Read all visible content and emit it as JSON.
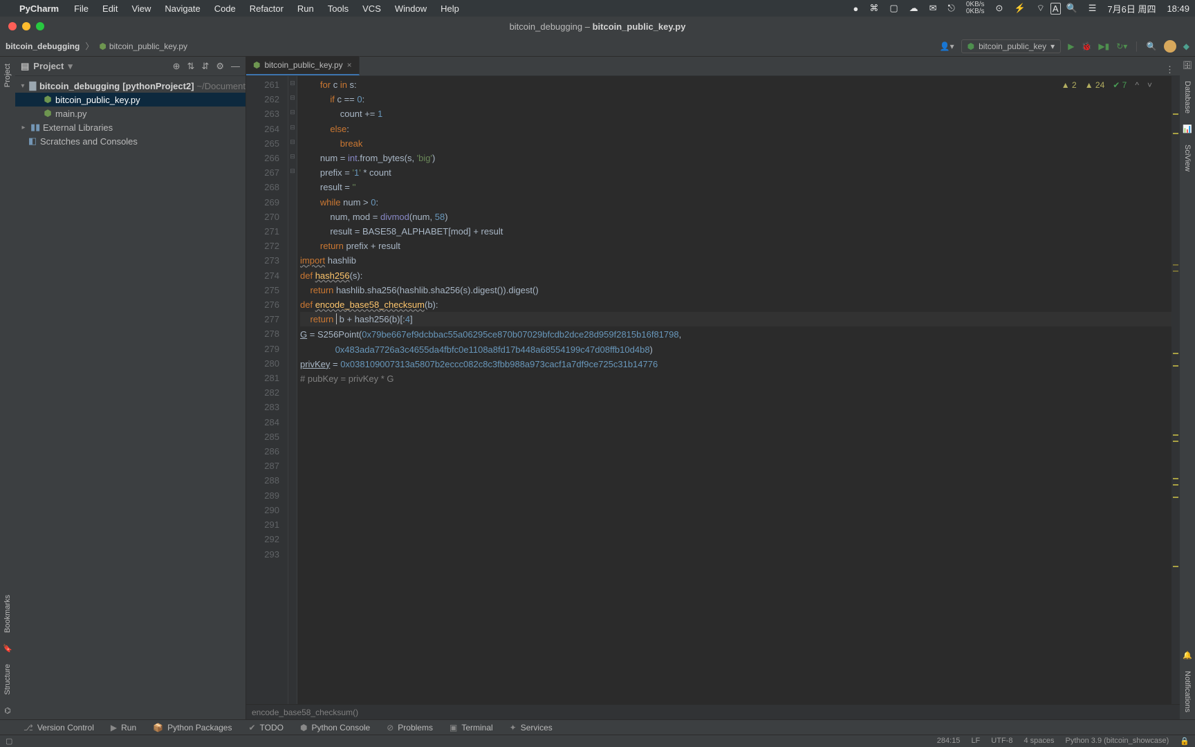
{
  "menubar": {
    "app": "PyCharm",
    "items": [
      "File",
      "Edit",
      "View",
      "Navigate",
      "Code",
      "Refactor",
      "Run",
      "Tools",
      "VCS",
      "Window",
      "Help"
    ],
    "net_up": "0KB/s",
    "net_down": "0KB/s",
    "date": "7月6日 周四",
    "time": "18:49",
    "ime": "A"
  },
  "titlebar": {
    "project": "bitcoin_debugging",
    "file": "bitcoin_public_key.py"
  },
  "breadcrumbs": {
    "root": "bitcoin_debugging",
    "file": "bitcoin_public_key.py"
  },
  "toolbar": {
    "run_config": "bitcoin_public_key"
  },
  "project_tool": {
    "title": "Project",
    "root": "bitcoin_debugging",
    "root_suffix": "[pythonProject2]",
    "root_path": "~/Document",
    "files": [
      "bitcoin_public_key.py",
      "main.py"
    ],
    "libs": "External Libraries",
    "scratch": "Scratches and Consoles"
  },
  "editor": {
    "tab_name": "bitcoin_public_key.py",
    "inspections": {
      "errors": "2",
      "warnings": "24",
      "ok": "7"
    },
    "crumbs": "encode_base58_checksum()",
    "first_line": 261,
    "lines": [
      "        for c in s:",
      "            if c == 0:",
      "                count += 1",
      "            else:",
      "                break",
      "",
      "        num = int.from_bytes(s, 'big')",
      "        prefix = '1' * count",
      "        result = ''",
      "        while num > 0:",
      "            num, mod = divmod(num, 58)",
      "            result = BASE58_ALPHABET[mod] + result",
      "",
      "        return prefix + result",
      "",
      "",
      "import hashlib",
      "",
      "def hash256(s):",
      "    return hashlib.sha256(hashlib.sha256(s).digest()).digest()",
      "",
      "",
      "def encode_base58_checksum(b):",
      "    return  b + hash256(b)[:4]",
      "",
      "",
      "",
      "",
      "G = S256Point(0x79be667ef9dcbbac55a06295ce870b07029bfcdb2dce28d959f2815b16f81798,",
      "              0x483ada7726a3c4655da4fbfc0e1108a8fd17b448a68554199c47d08ffb10d4b8)",
      "",
      "privKey = 0x038109007313a5807b2eccc082c8c3fbb988a973cacf1a7df9ce725c31b14776",
      "# pubKey = privKey * G"
    ],
    "caret_line_index": 23
  },
  "bottom_tools": {
    "items": [
      "Version Control",
      "Run",
      "Python Packages",
      "TODO",
      "Python Console",
      "Problems",
      "Terminal",
      "Services"
    ]
  },
  "statusbar": {
    "pos": "284:15",
    "sep": "LF",
    "enc": "UTF-8",
    "indent": "4 spaces",
    "interp": "Python 3.9 (bitcoin_showcase)"
  },
  "right_tools": {
    "items": [
      "Database",
      "SciView",
      "Notifications"
    ]
  }
}
